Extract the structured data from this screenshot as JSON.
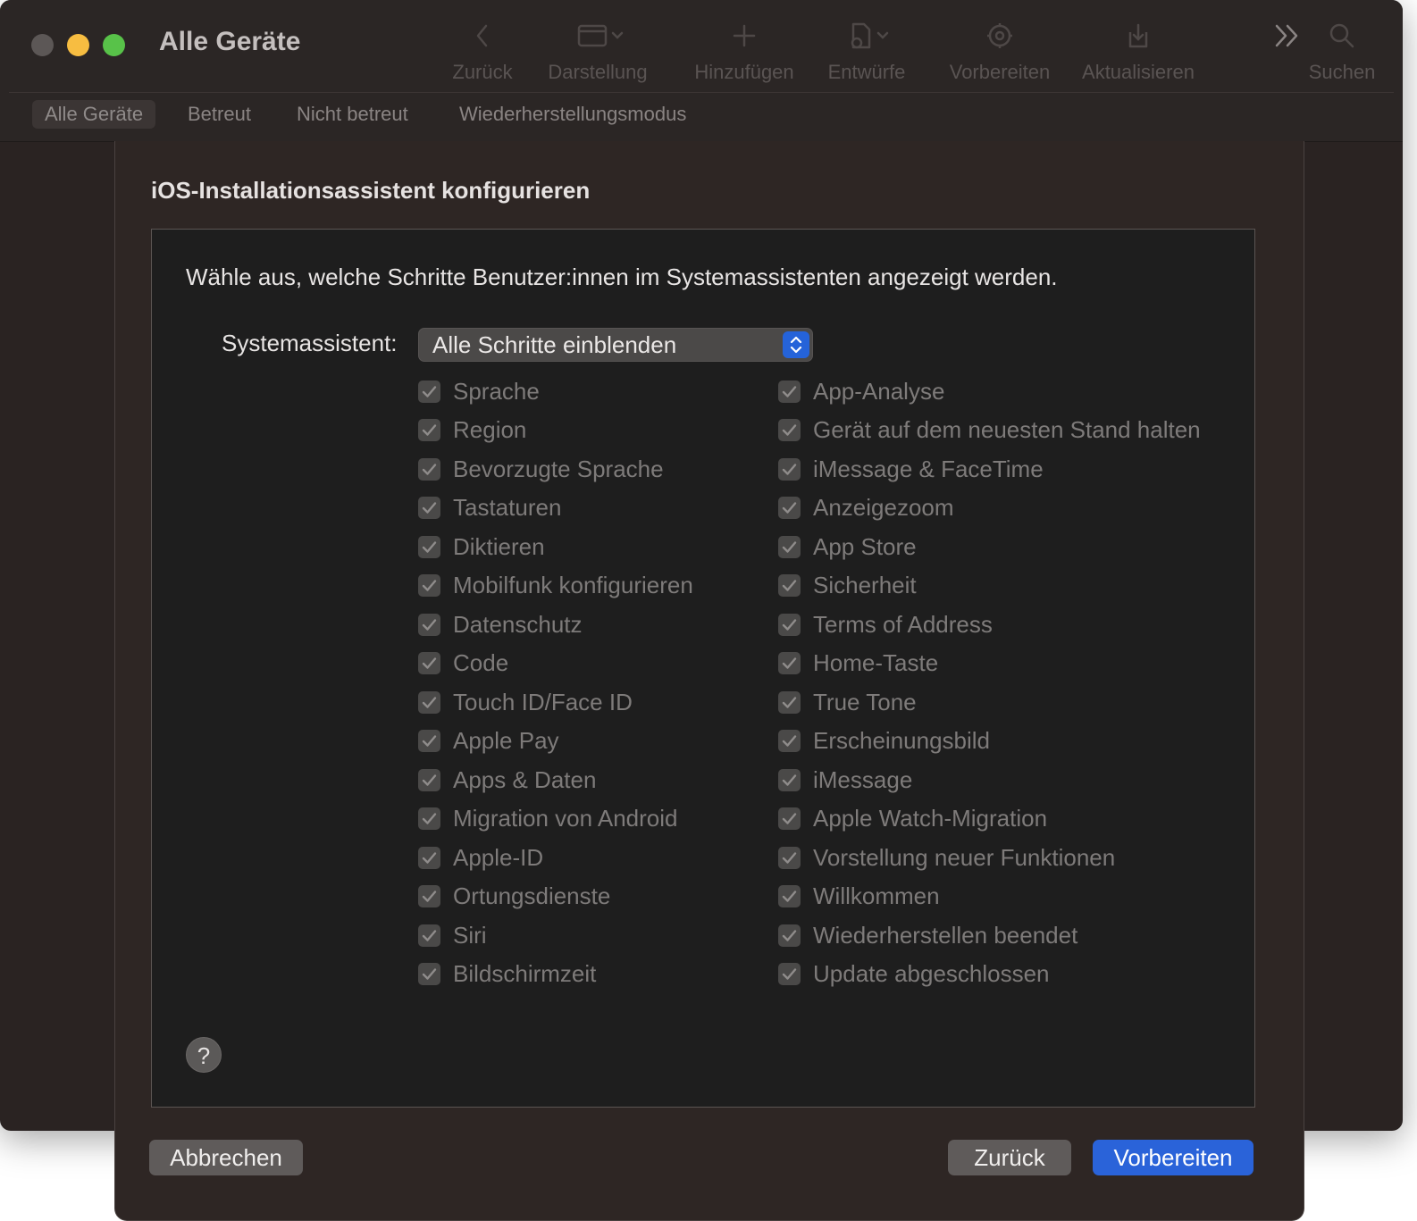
{
  "window": {
    "title": "Alle Geräte"
  },
  "toolbar": {
    "back_label": "Zurück",
    "view_label": "Darstellung",
    "add_label": "Hinzufügen",
    "drafts_label": "Entwürfe",
    "prepare_label": "Vorbereiten",
    "update_label": "Aktualisieren",
    "search_label": "Suchen"
  },
  "subtabs": {
    "all": "Alle Geräte",
    "supervised": "Betreut",
    "unsupervised": "Nicht betreut",
    "recovery": "Wiederherstellungsmodus",
    "active": "all"
  },
  "sheet": {
    "title": "iOS-Installationsassistent konfigurieren",
    "intro": "Wähle aus, welche Schritte Benutzer:innen im Systemassistenten angezeigt werden.",
    "assistant_label": "Systemassistent:",
    "assistant_value": "Alle Schritte einblenden",
    "help": "?",
    "cancel_label": "Abbrechen",
    "back_label": "Zurück",
    "prepare_label": "Vorbereiten"
  },
  "steps_left": [
    {
      "label": "Sprache",
      "checked": true
    },
    {
      "label": "Region",
      "checked": true
    },
    {
      "label": "Bevorzugte Sprache",
      "checked": true
    },
    {
      "label": "Tastaturen",
      "checked": true
    },
    {
      "label": "Diktieren",
      "checked": true
    },
    {
      "label": "Mobilfunk konfigurieren",
      "checked": true
    },
    {
      "label": "Datenschutz",
      "checked": true
    },
    {
      "label": "Code",
      "checked": true
    },
    {
      "label": "Touch ID/Face ID",
      "checked": true
    },
    {
      "label": "Apple Pay",
      "checked": true
    },
    {
      "label": "Apps & Daten",
      "checked": true
    },
    {
      "label": "Migration von Android",
      "checked": true
    },
    {
      "label": "Apple-ID",
      "checked": true
    },
    {
      "label": "Ortungsdienste",
      "checked": true
    },
    {
      "label": "Siri",
      "checked": true
    },
    {
      "label": "Bildschirmzeit",
      "checked": true
    }
  ],
  "steps_right": [
    {
      "label": "App-Analyse",
      "checked": true
    },
    {
      "label": "Gerät auf dem neuesten Stand halten",
      "checked": true
    },
    {
      "label": "iMessage & FaceTime",
      "checked": true
    },
    {
      "label": "Anzeigezoom",
      "checked": true
    },
    {
      "label": "App Store",
      "checked": true
    },
    {
      "label": "Sicherheit",
      "checked": true
    },
    {
      "label": "Terms of Address",
      "checked": true
    },
    {
      "label": "Home-Taste",
      "checked": true
    },
    {
      "label": "True Tone",
      "checked": true
    },
    {
      "label": "Erscheinungsbild",
      "checked": true
    },
    {
      "label": "iMessage",
      "checked": true
    },
    {
      "label": "Apple Watch-Migration",
      "checked": true
    },
    {
      "label": "Vorstellung neuer Funktionen",
      "checked": true
    },
    {
      "label": "Willkommen",
      "checked": true
    },
    {
      "label": "Wiederherstellen beendet",
      "checked": true
    },
    {
      "label": "Update abgeschlossen",
      "checked": true
    }
  ],
  "colors": {
    "accent": "#2a63d9",
    "window_bg": "#2a2322",
    "panel_bg": "#1e1e1e",
    "disabled_text": "#7e7b7a"
  }
}
